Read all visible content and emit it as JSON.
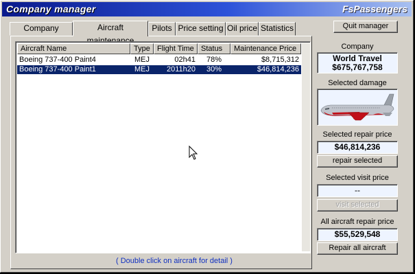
{
  "window": {
    "title": "Company manager",
    "brand": "FsPassengers"
  },
  "tabs": [
    {
      "label": "Company Aircraft",
      "active": false
    },
    {
      "label": "Aircraft maintenance",
      "active": true
    },
    {
      "label": "Pilots",
      "active": false
    },
    {
      "label": "Price setting",
      "active": false
    },
    {
      "label": "Oil price",
      "active": false
    },
    {
      "label": "Statistics",
      "active": false
    }
  ],
  "quit_button": "Quit manager",
  "table": {
    "columns": [
      "Aircraft Name",
      "Type",
      "Flight Time",
      "Status",
      "Maintenance Price"
    ],
    "rows": [
      {
        "name": "Boeing 737-400 Paint4",
        "type": "MEJ",
        "flight_time": "02h41",
        "status": "78%",
        "price": "$8,715,312",
        "selected": false
      },
      {
        "name": "Boeing 737-400 Paint1",
        "type": "MEJ",
        "flight_time": "2011h20",
        "status": "30%",
        "price": "$46,814,236",
        "selected": true
      }
    ]
  },
  "hint": "( Double click on aircraft for detail )",
  "side": {
    "company_label": "Company",
    "company_name": "World Travel",
    "company_money": "$675,767,758",
    "damage_label": "Selected damage",
    "repair_price_label": "Selected repair price",
    "repair_price": "$46,814,236",
    "repair_button": "repair selected",
    "visit_price_label": "Selected visit price",
    "visit_price": "--",
    "visit_button": "visit selected",
    "all_repair_label": "All aircraft repair price",
    "all_repair_price": "$55,529,548",
    "all_repair_button": "Repair all aircraft"
  },
  "colors": {
    "selection": "#0a246a",
    "damage_red": "#c0101a",
    "hint_blue": "#1030c0"
  },
  "icons": {
    "aircraft_damage": "airplane-damage-icon",
    "cursor": "mouse-pointer-icon"
  }
}
